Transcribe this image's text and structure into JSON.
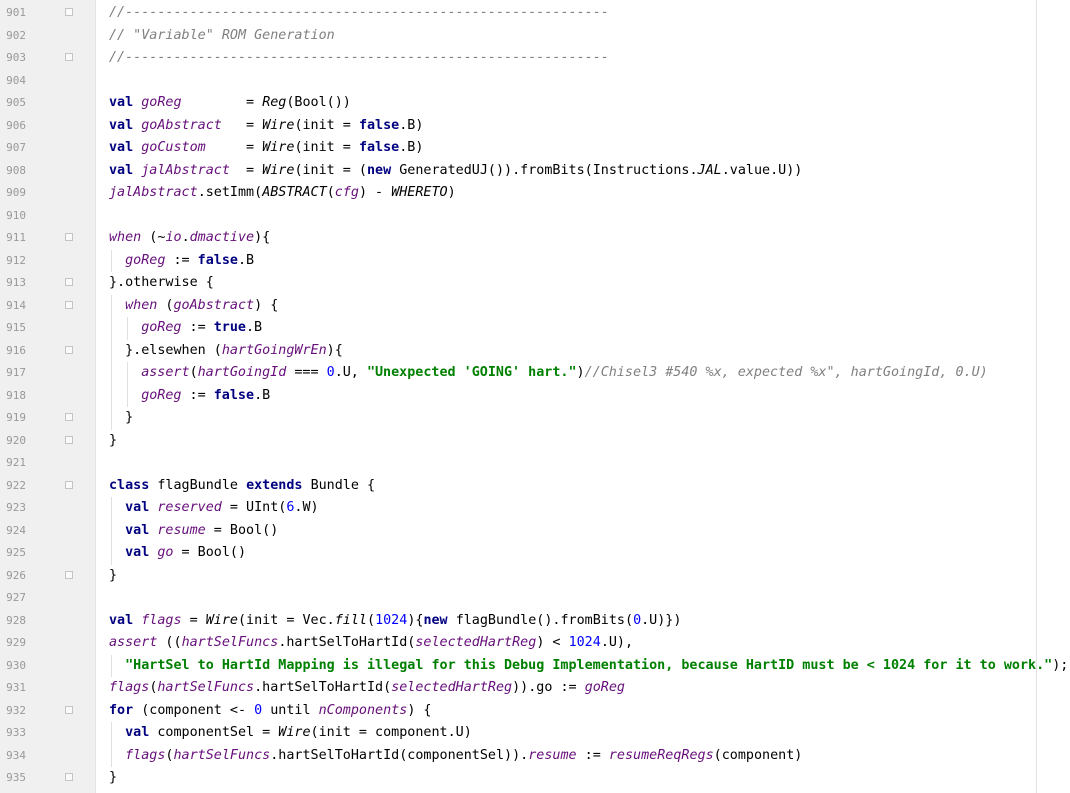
{
  "editor": {
    "lines": [
      {
        "n": "901",
        "fold": "start",
        "indent": 0,
        "tokens": [
          [
            "cm",
            "//------------------------------------------------------------"
          ]
        ]
      },
      {
        "n": "902",
        "fold": "",
        "indent": 0,
        "tokens": [
          [
            "cm",
            "// \"Variable\" ROM Generation"
          ]
        ]
      },
      {
        "n": "903",
        "fold": "end",
        "indent": 0,
        "tokens": [
          [
            "cm",
            "//------------------------------------------------------------"
          ]
        ]
      },
      {
        "n": "904",
        "fold": "",
        "indent": 0,
        "tokens": []
      },
      {
        "n": "905",
        "fold": "",
        "indent": 0,
        "tokens": [
          [
            "kw",
            "val "
          ],
          [
            "it",
            "goReg"
          ],
          [
            "pl",
            "        = "
          ],
          [
            "fn",
            "Reg"
          ],
          [
            "pl",
            "(Bool())"
          ]
        ]
      },
      {
        "n": "906",
        "fold": "",
        "indent": 0,
        "tokens": [
          [
            "kw",
            "val "
          ],
          [
            "it",
            "goAbstract"
          ],
          [
            "pl",
            "   = "
          ],
          [
            "fn",
            "Wire"
          ],
          [
            "pl",
            "(init = "
          ],
          [
            "kw",
            "false"
          ],
          [
            "pl",
            ".B)"
          ]
        ]
      },
      {
        "n": "907",
        "fold": "",
        "indent": 0,
        "tokens": [
          [
            "kw",
            "val "
          ],
          [
            "it",
            "goCustom"
          ],
          [
            "pl",
            "     = "
          ],
          [
            "fn",
            "Wire"
          ],
          [
            "pl",
            "(init = "
          ],
          [
            "kw",
            "false"
          ],
          [
            "pl",
            ".B)"
          ]
        ]
      },
      {
        "n": "908",
        "fold": "",
        "indent": 0,
        "tokens": [
          [
            "kw",
            "val "
          ],
          [
            "it",
            "jalAbstract"
          ],
          [
            "pl",
            "  = "
          ],
          [
            "fn",
            "Wire"
          ],
          [
            "pl",
            "(init = ("
          ],
          [
            "kw",
            "new "
          ],
          [
            "pl",
            "GeneratedUJ()).fromBits(Instructions."
          ],
          [
            "fn",
            "JAL"
          ],
          [
            "pl",
            ".value.U))"
          ]
        ]
      },
      {
        "n": "909",
        "fold": "",
        "indent": 0,
        "tokens": [
          [
            "it",
            "jalAbstract"
          ],
          [
            "pl",
            ".setImm("
          ],
          [
            "fn",
            "ABSTRACT"
          ],
          [
            "pl",
            "("
          ],
          [
            "it",
            "cfg"
          ],
          [
            "pl",
            ") - "
          ],
          [
            "fn",
            "WHERETO"
          ],
          [
            "pl",
            ")"
          ]
        ]
      },
      {
        "n": "910",
        "fold": "",
        "indent": 0,
        "tokens": []
      },
      {
        "n": "911",
        "fold": "start",
        "indent": 0,
        "tokens": [
          [
            "it",
            "when"
          ],
          [
            "pl",
            " (~"
          ],
          [
            "it",
            "io"
          ],
          [
            "pl",
            "."
          ],
          [
            "it",
            "dmactive"
          ],
          [
            "pl",
            "){"
          ]
        ]
      },
      {
        "n": "912",
        "fold": "",
        "indent": 1,
        "tokens": [
          [
            "it",
            "goReg"
          ],
          [
            "pl",
            " := "
          ],
          [
            "kw",
            "false"
          ],
          [
            "pl",
            ".B"
          ]
        ]
      },
      {
        "n": "913",
        "fold": "start",
        "indent": 0,
        "tokens": [
          [
            "pl",
            "}.otherwise {"
          ]
        ]
      },
      {
        "n": "914",
        "fold": "start",
        "indent": 1,
        "tokens": [
          [
            "it",
            "when"
          ],
          [
            "pl",
            " ("
          ],
          [
            "it",
            "goAbstract"
          ],
          [
            "pl",
            ") {"
          ]
        ]
      },
      {
        "n": "915",
        "fold": "",
        "indent": 2,
        "tokens": [
          [
            "it",
            "goReg"
          ],
          [
            "pl",
            " := "
          ],
          [
            "kw",
            "true"
          ],
          [
            "pl",
            ".B"
          ]
        ]
      },
      {
        "n": "916",
        "fold": "start",
        "indent": 1,
        "tokens": [
          [
            "pl",
            "}.elsewhen ("
          ],
          [
            "it",
            "hartGoingWrEn"
          ],
          [
            "pl",
            "){"
          ]
        ]
      },
      {
        "n": "917",
        "fold": "",
        "indent": 2,
        "tokens": [
          [
            "it",
            "assert"
          ],
          [
            "pl",
            "("
          ],
          [
            "it",
            "hartGoingId"
          ],
          [
            "pl",
            " === "
          ],
          [
            "nm",
            "0"
          ],
          [
            "pl",
            ".U, "
          ],
          [
            "st",
            "\"Unexpected 'GOING' hart.\""
          ],
          [
            "pl",
            ")"
          ],
          [
            "cm",
            "//Chisel3 #540 %x, expected %x\", hartGoingId, 0.U)"
          ]
        ]
      },
      {
        "n": "918",
        "fold": "",
        "indent": 2,
        "tokens": [
          [
            "it",
            "goReg"
          ],
          [
            "pl",
            " := "
          ],
          [
            "kw",
            "false"
          ],
          [
            "pl",
            ".B"
          ]
        ]
      },
      {
        "n": "919",
        "fold": "end",
        "indent": 1,
        "tokens": [
          [
            "pl",
            "}"
          ]
        ]
      },
      {
        "n": "920",
        "fold": "end",
        "indent": 0,
        "tokens": [
          [
            "pl",
            "}"
          ]
        ]
      },
      {
        "n": "921",
        "fold": "",
        "indent": 0,
        "tokens": []
      },
      {
        "n": "922",
        "fold": "start",
        "indent": 0,
        "tokens": [
          [
            "kw",
            "class "
          ],
          [
            "pl",
            "flagBundle "
          ],
          [
            "kw",
            "extends "
          ],
          [
            "pl",
            "Bundle {"
          ]
        ]
      },
      {
        "n": "923",
        "fold": "",
        "indent": 1,
        "tokens": [
          [
            "kw",
            "val "
          ],
          [
            "it",
            "reserved"
          ],
          [
            "pl",
            " = UInt("
          ],
          [
            "nm",
            "6"
          ],
          [
            "pl",
            ".W)"
          ]
        ]
      },
      {
        "n": "924",
        "fold": "",
        "indent": 1,
        "tokens": [
          [
            "kw",
            "val "
          ],
          [
            "it",
            "resume"
          ],
          [
            "pl",
            " = Bool()"
          ]
        ]
      },
      {
        "n": "925",
        "fold": "",
        "indent": 1,
        "tokens": [
          [
            "kw",
            "val "
          ],
          [
            "it",
            "go"
          ],
          [
            "pl",
            " = Bool()"
          ]
        ]
      },
      {
        "n": "926",
        "fold": "end",
        "indent": 0,
        "tokens": [
          [
            "pl",
            "}"
          ]
        ]
      },
      {
        "n": "927",
        "fold": "",
        "indent": 0,
        "tokens": []
      },
      {
        "n": "928",
        "fold": "",
        "indent": 0,
        "tokens": [
          [
            "kw",
            "val "
          ],
          [
            "it",
            "flags"
          ],
          [
            "pl",
            " = "
          ],
          [
            "fn",
            "Wire"
          ],
          [
            "pl",
            "(init = Vec."
          ],
          [
            "fn",
            "fill"
          ],
          [
            "pl",
            "("
          ],
          [
            "nm",
            "1024"
          ],
          [
            "pl",
            "){"
          ],
          [
            "kw",
            "new "
          ],
          [
            "pl",
            "flagBundle().fromBits("
          ],
          [
            "nm",
            "0"
          ],
          [
            "pl",
            ".U)})"
          ]
        ]
      },
      {
        "n": "929",
        "fold": "",
        "indent": 0,
        "tokens": [
          [
            "it",
            "assert"
          ],
          [
            "pl",
            " (("
          ],
          [
            "it",
            "hartSelFuncs"
          ],
          [
            "pl",
            ".hartSelToHartId("
          ],
          [
            "it",
            "selectedHartReg"
          ],
          [
            "pl",
            ") < "
          ],
          [
            "nm",
            "1024"
          ],
          [
            "pl",
            ".U),"
          ]
        ]
      },
      {
        "n": "930",
        "fold": "",
        "indent": 1,
        "tokens": [
          [
            "st",
            "\"HartSel to HartId Mapping is illegal for this Debug Implementation, because HartID must be < 1024 for it to work.\""
          ],
          [
            "pl",
            ");"
          ]
        ]
      },
      {
        "n": "931",
        "fold": "",
        "indent": 0,
        "tokens": [
          [
            "it",
            "flags"
          ],
          [
            "pl",
            "("
          ],
          [
            "it",
            "hartSelFuncs"
          ],
          [
            "pl",
            ".hartSelToHartId("
          ],
          [
            "it",
            "selectedHartReg"
          ],
          [
            "pl",
            ")).go := "
          ],
          [
            "it",
            "goReg"
          ]
        ]
      },
      {
        "n": "932",
        "fold": "start",
        "indent": 0,
        "tokens": [
          [
            "kw",
            "for"
          ],
          [
            "pl",
            " (component <- "
          ],
          [
            "nm",
            "0"
          ],
          [
            "pl",
            " until "
          ],
          [
            "it",
            "nComponents"
          ],
          [
            "pl",
            ") {"
          ]
        ]
      },
      {
        "n": "933",
        "fold": "",
        "indent": 1,
        "tokens": [
          [
            "kw",
            "val "
          ],
          [
            "pl",
            "componentSel = "
          ],
          [
            "fn",
            "Wire"
          ],
          [
            "pl",
            "(init = component.U)"
          ]
        ]
      },
      {
        "n": "934",
        "fold": "",
        "indent": 1,
        "tokens": [
          [
            "it",
            "flags"
          ],
          [
            "pl",
            "("
          ],
          [
            "it",
            "hartSelFuncs"
          ],
          [
            "pl",
            ".hartSelToHartId(componentSel))."
          ],
          [
            "it",
            "resume"
          ],
          [
            "pl",
            " := "
          ],
          [
            "it",
            "resumeReqRegs"
          ],
          [
            "pl",
            "(component)"
          ]
        ]
      },
      {
        "n": "935",
        "fold": "end",
        "indent": 0,
        "tokens": [
          [
            "pl",
            "}"
          ]
        ]
      }
    ]
  }
}
